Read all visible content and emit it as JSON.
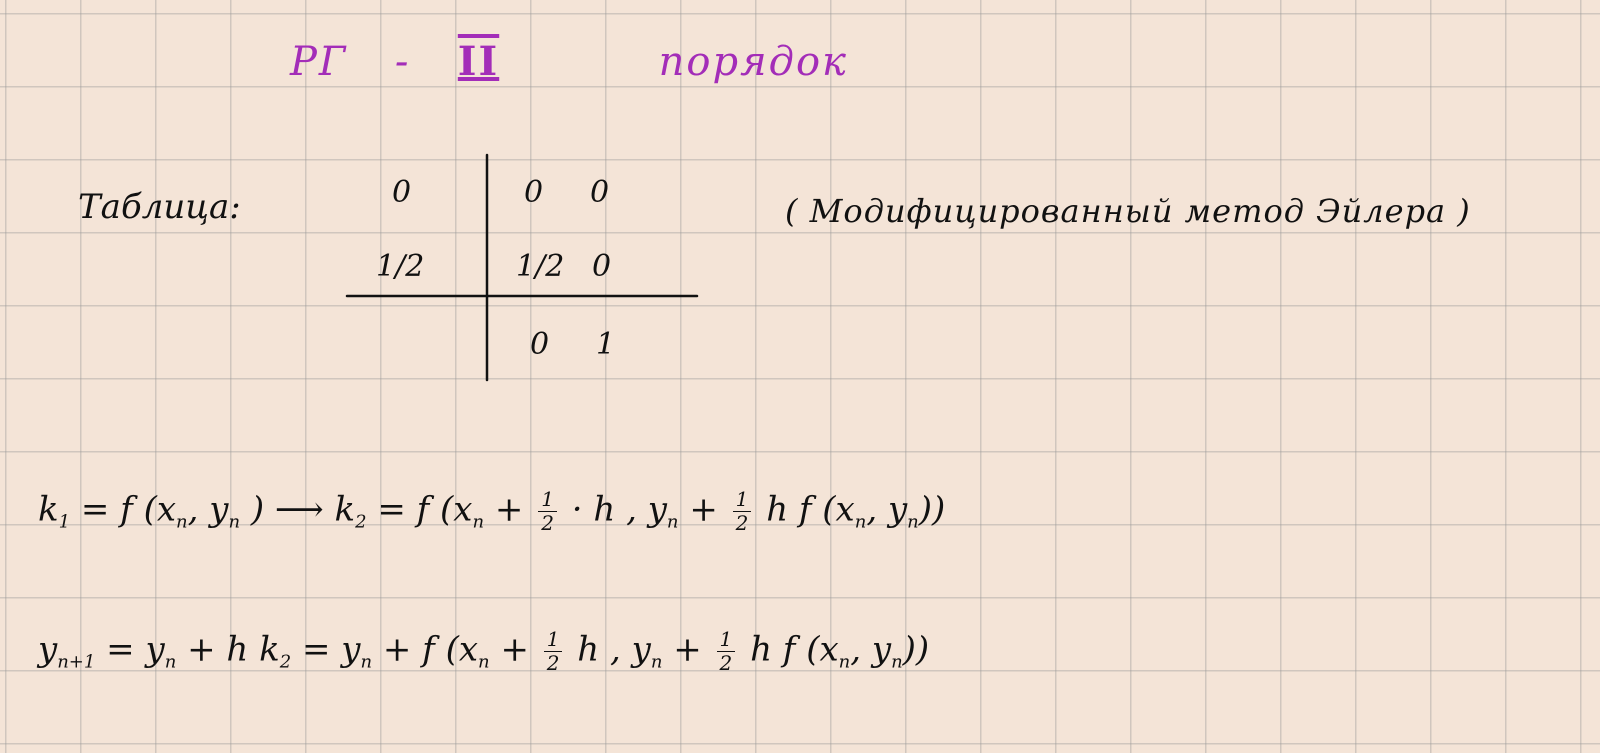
{
  "title": {
    "prefix": "РГ",
    "dash": "-",
    "order": "II",
    "suffix": "порядок"
  },
  "table": {
    "label": "Таблица:",
    "rows": [
      {
        "c": "0",
        "a1": "0",
        "a2": "0"
      },
      {
        "c": "1/2",
        "a1": "1/2",
        "a2": "0"
      }
    ],
    "b": {
      "b1": "0",
      "b2": "1"
    }
  },
  "method_note": "( Модифицированный метод Эйлера )",
  "formulas": {
    "line1": {
      "k1_lhs": "k",
      "k1_sub": "1",
      "k1_rhs": "= f (x",
      "k1_args_tail": ", y",
      "k1_close": ")",
      "arrow": "⟶",
      "k2_lhs": "k",
      "k2_sub": "2",
      "k2_eq": "= f (x",
      "plus1": "+",
      "half_num": "1",
      "half_den": "2",
      "times_h": "· h , y",
      "plus2": "+",
      "h_f": "h f (x",
      "comma": ", y",
      "close": "))",
      "sub_n": "n"
    },
    "line2": {
      "y_lhs": "y",
      "y_sub": "n+1",
      "eq1": "= y",
      "plus_h_k": "+ h k",
      "k_sub": "2",
      "eq2": "= y",
      "plus_f": "+ f (x",
      "plus3": "+",
      "half_num": "1",
      "half_den": "2",
      "h_y": "h , y",
      "plus4": "+",
      "h_f2": "h f (x",
      "comma2": ", y",
      "close2": "))",
      "sub_n": "n"
    }
  }
}
